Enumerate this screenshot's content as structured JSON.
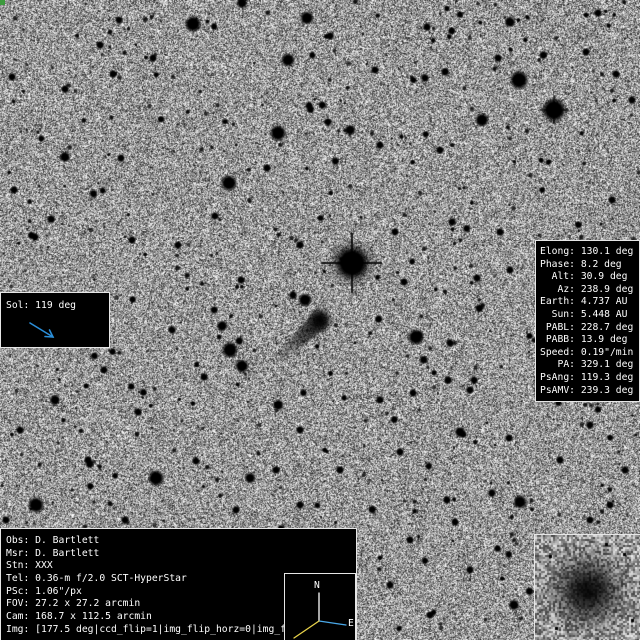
{
  "ephemeris": [
    {
      "label": "Elong:",
      "value": "130.1 deg"
    },
    {
      "label": "Phase:",
      "value": "8.2 deg"
    },
    {
      "label": "Alt:",
      "value": "30.9 deg"
    },
    {
      "label": "Az:",
      "value": "238.9 deg"
    },
    {
      "label": "Earth:",
      "value": "4.737 AU"
    },
    {
      "label": "Sun:",
      "value": "5.448 AU"
    },
    {
      "label": "PABL:",
      "value": "228.7 deg"
    },
    {
      "label": "PABB:",
      "value": "13.9 deg"
    },
    {
      "label": "Speed:",
      "value": "0.19\"/min"
    },
    {
      "label": "PA:",
      "value": "329.1 deg"
    },
    {
      "label": "PsAng:",
      "value": "119.3 deg"
    },
    {
      "label": "PsAMV:",
      "value": "239.3 deg"
    }
  ],
  "sun_panel": {
    "label": "Sol:",
    "value": "119 deg",
    "arrow_icon": "sun-direction-arrow-icon",
    "arrow_color": "#2b8ed8"
  },
  "observation": [
    {
      "label": "Obs:",
      "value": "D. Bartlett"
    },
    {
      "label": "Msr:",
      "value": "D. Bartlett"
    },
    {
      "label": "Stn:",
      "value": "XXX"
    },
    {
      "label": "Tel:",
      "value": "0.36-m f/2.0 SCT-HyperStar"
    },
    {
      "label": "PSc:",
      "value": "1.06\"/px"
    },
    {
      "label": "FOV:",
      "value": "27.2 x 27.2 arcmin"
    },
    {
      "label": "Cam:",
      "value": "168.7 x 112.5 arcmin"
    },
    {
      "label": "Img:",
      "value": "[177.5 deg|ccd_flip=1|img_flip_horz=0|img_f"
    }
  ],
  "compass": {
    "icon": "compass-rose-icon",
    "north_label": "N",
    "east_label": "E",
    "north_color": "#ffffff",
    "east_color": "#4aa8e8",
    "motion_color": "#e8d24a"
  },
  "colors": {
    "panel_bg": "#000000",
    "panel_text": "#ffffff",
    "panel_border": "#e6e6e6",
    "corner_marker": "#3c9a3c"
  }
}
